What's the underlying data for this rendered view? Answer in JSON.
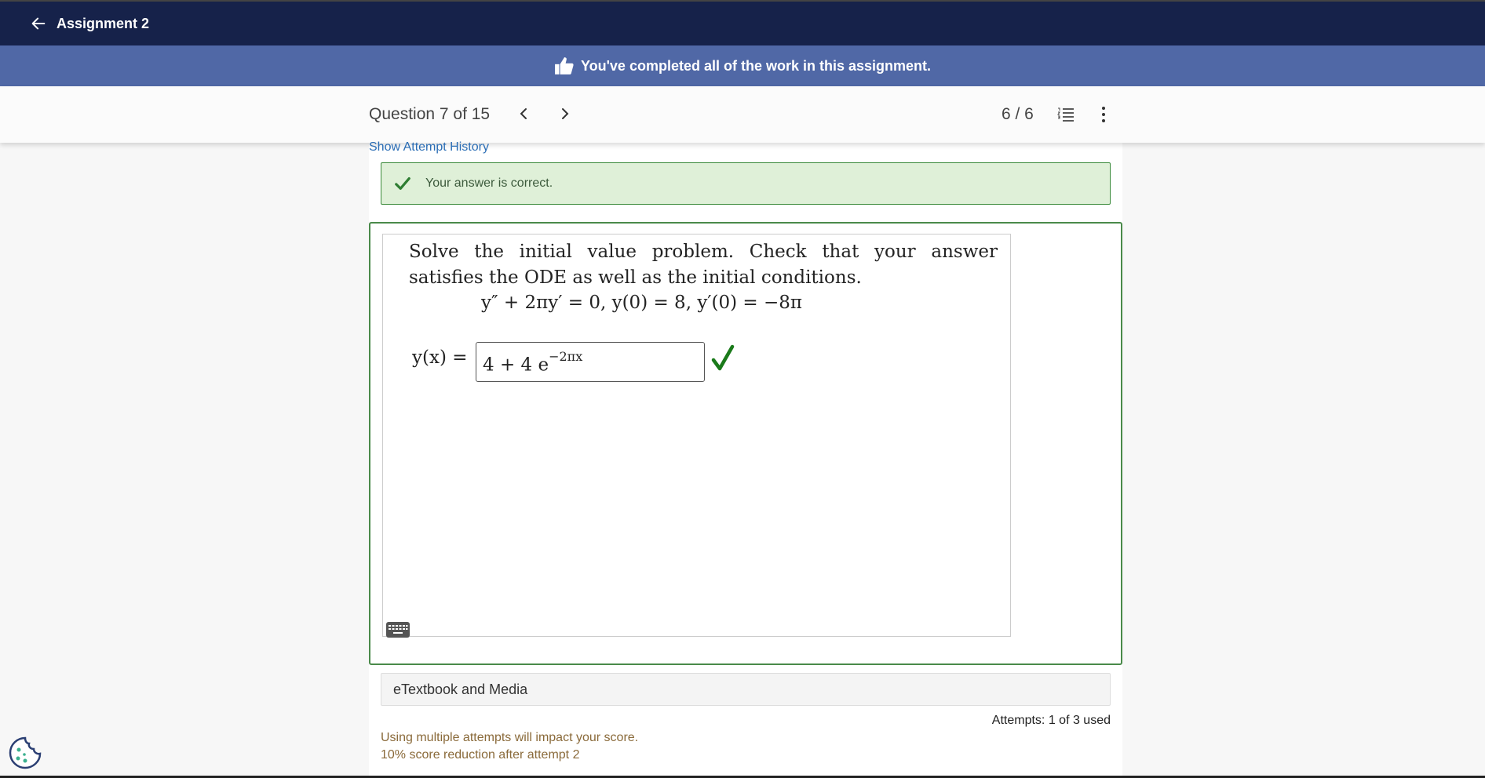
{
  "header": {
    "back_icon": "arrow-left-icon",
    "title": "Assignment 2"
  },
  "banner": {
    "icon": "thumbs-up-icon",
    "message": "You've completed all of the work in this assignment."
  },
  "question_nav": {
    "label": "Question 7 of 15",
    "prev_icon": "chevron-left-icon",
    "next_icon": "chevron-right-icon",
    "score": "6 / 6",
    "list_icon": "list-icon",
    "more_icon": "more-vertical-icon"
  },
  "attempt_history_link": "Show Attempt History",
  "feedback": {
    "icon": "check-icon",
    "message": "Your answer is correct."
  },
  "problem": {
    "prompt": "Solve the initial value problem. Check that your answer satisfies the ODE as well as the initial conditions.",
    "equation": "y″ + 2πy′ = 0, y(0) = 8, y′(0) = −8π",
    "answer_label": "y(x) =",
    "answer_base": "4 + 4 e",
    "answer_exponent": "−2πx",
    "result_icon": "green-check-icon",
    "keyboard_icon": "keyboard-icon"
  },
  "etextbook_label": "eTextbook and Media",
  "attempts": {
    "text": "Attempts: 1 of 3 used"
  },
  "notes": {
    "line1": "Using multiple attempts will impact your score.",
    "line2": "10% score reduction after attempt 2"
  },
  "cookie_icon": "cookie-icon",
  "colors": {
    "topbar": "#16224a",
    "banner": "#5068a6",
    "success_bg": "#dff0d8",
    "success_border": "#3a8a3a",
    "link": "#2a6db5"
  }
}
